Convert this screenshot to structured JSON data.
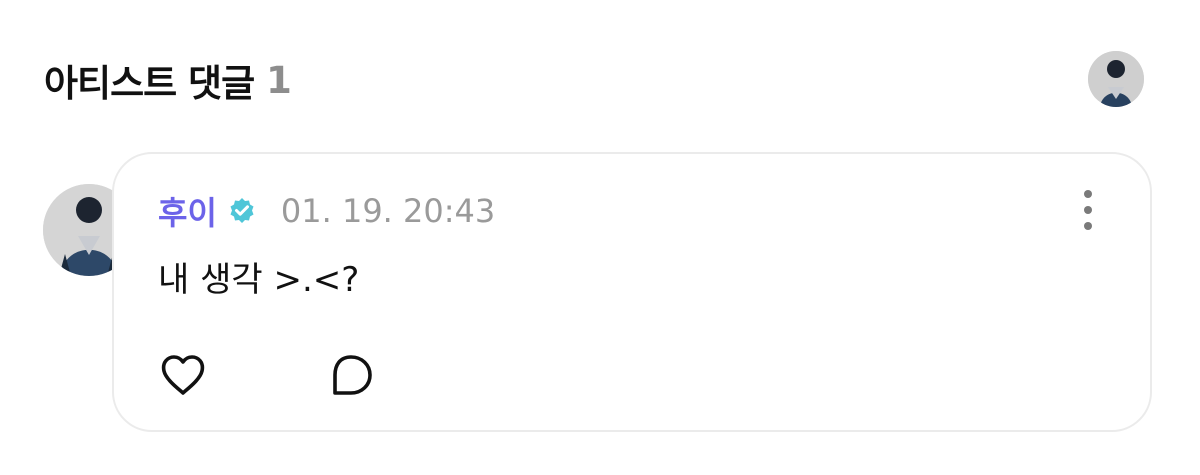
{
  "section": {
    "title": "아티스트 댓글",
    "count": "1"
  },
  "comment": {
    "author": "후이",
    "verified": true,
    "timestamp": "01. 19. 20:43",
    "text": "내 생각 >.<?"
  },
  "icons": {
    "header_avatar": "avatar",
    "verified": "verified-check-icon",
    "more": "more-vertical-icon",
    "like": "heart-icon",
    "reply": "comment-bubble-icon"
  },
  "colors": {
    "author": "#6c63e9",
    "verified_badge": "#4fc6d8",
    "timestamp": "#9a9a9a",
    "border": "#ebebeb",
    "count": "#8d8d8d"
  }
}
